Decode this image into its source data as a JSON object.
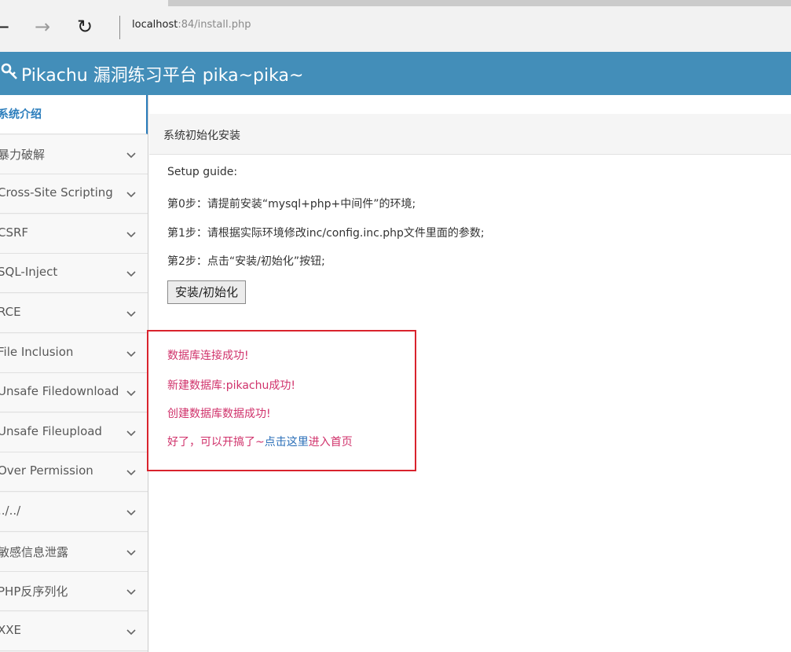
{
  "browser": {
    "back_glyph": "←",
    "forward_glyph": "→",
    "refresh_glyph": "↻",
    "url_host": "localhost",
    "url_rest": ":84/install.php"
  },
  "header": {
    "brand_icon": "key-icon",
    "brand_text": "Pikachu 漏洞练习平台 pika~pika~"
  },
  "sidebar": {
    "items": [
      {
        "label": "系统介绍",
        "active": true
      },
      {
        "label": "暴力破解"
      },
      {
        "label": "Cross-Site Scripting"
      },
      {
        "label": "CSRF"
      },
      {
        "label": "SQL-Inject"
      },
      {
        "label": "RCE"
      },
      {
        "label": "File Inclusion"
      },
      {
        "label": "Unsafe Filedownload"
      },
      {
        "label": "Unsafe Fileupload"
      },
      {
        "label": "Over Permission"
      },
      {
        "label": "../../"
      },
      {
        "label": "敏感信息泄露"
      },
      {
        "label": "PHP反序列化"
      },
      {
        "label": "XXE"
      }
    ]
  },
  "main": {
    "title": "系统初始化安装",
    "guide_title": "Setup guide:",
    "step0": "第0步：请提前安装“mysql+php+中间件”的环境;",
    "step1": "第1步：请根据实际环境修改inc/config.inc.php文件里面的参数;",
    "step2": "第2步：点击“安装/初始化”按钮;",
    "install_button": "安装/初始化"
  },
  "result": {
    "line1": "数据库连接成功!",
    "line2": "新建数据库:pikachu成功!",
    "line3": "创建数据库数据成功!",
    "line4_prefix": "好了，可以开搞了~",
    "line4_link": "点击这里",
    "line4_suffix": "进入首页"
  },
  "colors": {
    "header_bg": "#438eb9",
    "accent": "#2b7dbc",
    "message": "#d0326b",
    "box_border": "#d9232d"
  }
}
